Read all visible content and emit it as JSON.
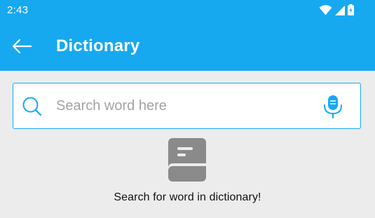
{
  "status_bar": {
    "time": "2:43",
    "icons": [
      "wifi-icon",
      "cellular-signal-icon",
      "battery-charging-icon"
    ]
  },
  "app_bar": {
    "title": "Dictionary",
    "back_icon": "arrow-left-icon"
  },
  "search": {
    "value": "",
    "placeholder": "Search word here",
    "search_icon": "search-icon",
    "voice_icon": "microphone-icon"
  },
  "empty_state": {
    "icon": "book-icon",
    "message": "Search for word in dictionary!"
  },
  "colors": {
    "primary": "#16a9f0",
    "background": "#ececec",
    "placeholder": "#a3a3a3",
    "empty_icon": "#8a8a8a"
  }
}
